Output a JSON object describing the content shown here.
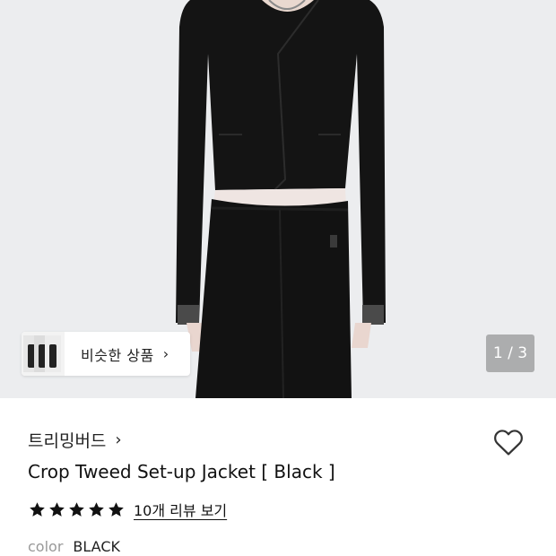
{
  "product_image": {
    "pager": "1 / 3",
    "similar_button": {
      "label": "비슷한 상품",
      "chevron_icon": "chevron-right-icon"
    }
  },
  "brand": {
    "name": "트리밍버드",
    "chevron_icon": "chevron-right-icon"
  },
  "wishlist_icon": "heart-outline-icon",
  "product": {
    "title": "Crop Tweed Set-up Jacket [ Black ]"
  },
  "rating": {
    "stars": 5,
    "star_color": "#111111",
    "review_link": "10개 리뷰 보기"
  },
  "option": {
    "label": "color",
    "value": "BLACK"
  }
}
